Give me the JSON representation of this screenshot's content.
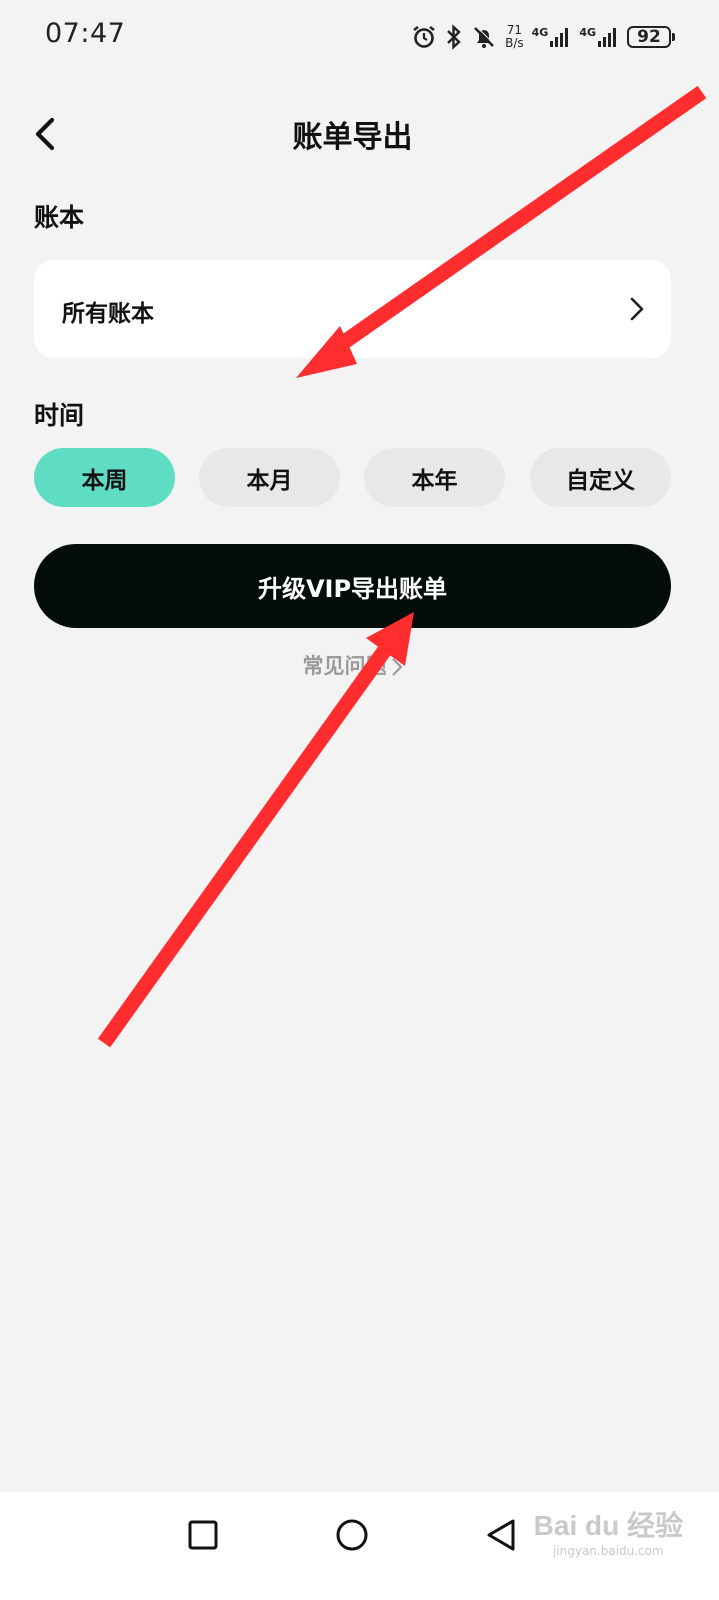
{
  "status_bar": {
    "time": "07:47",
    "net_speed_value": "71",
    "net_speed_unit": "B/s",
    "sim1": "4G",
    "sim2": "4G",
    "battery": "92",
    "icons": [
      "alarm-icon",
      "bluetooth-icon",
      "muted-bell-icon",
      "signal-icon",
      "battery-icon"
    ]
  },
  "header": {
    "title": "账单导出",
    "back_icon": "chevron-left-icon"
  },
  "account_section": {
    "label": "账本",
    "selected_book": "所有账本"
  },
  "time_section": {
    "label": "时间",
    "options": [
      "本周",
      "本月",
      "本年",
      "自定义"
    ],
    "selected": "本周"
  },
  "actions": {
    "upgrade_export_label": "升级VIP导出账单",
    "faq_label": "常见问题"
  },
  "annotations": {
    "arrow_color": "#ff2d2d"
  },
  "colors": {
    "accent": "#5fdcc4",
    "primary_button": "#050d0a",
    "background": "#f3f3f3"
  },
  "watermark": {
    "brand": "Bai du 经验",
    "url": "jingyan.baidu.com"
  },
  "nav_bar": {
    "icons": [
      "recent-apps-icon",
      "home-icon",
      "back-icon"
    ]
  }
}
